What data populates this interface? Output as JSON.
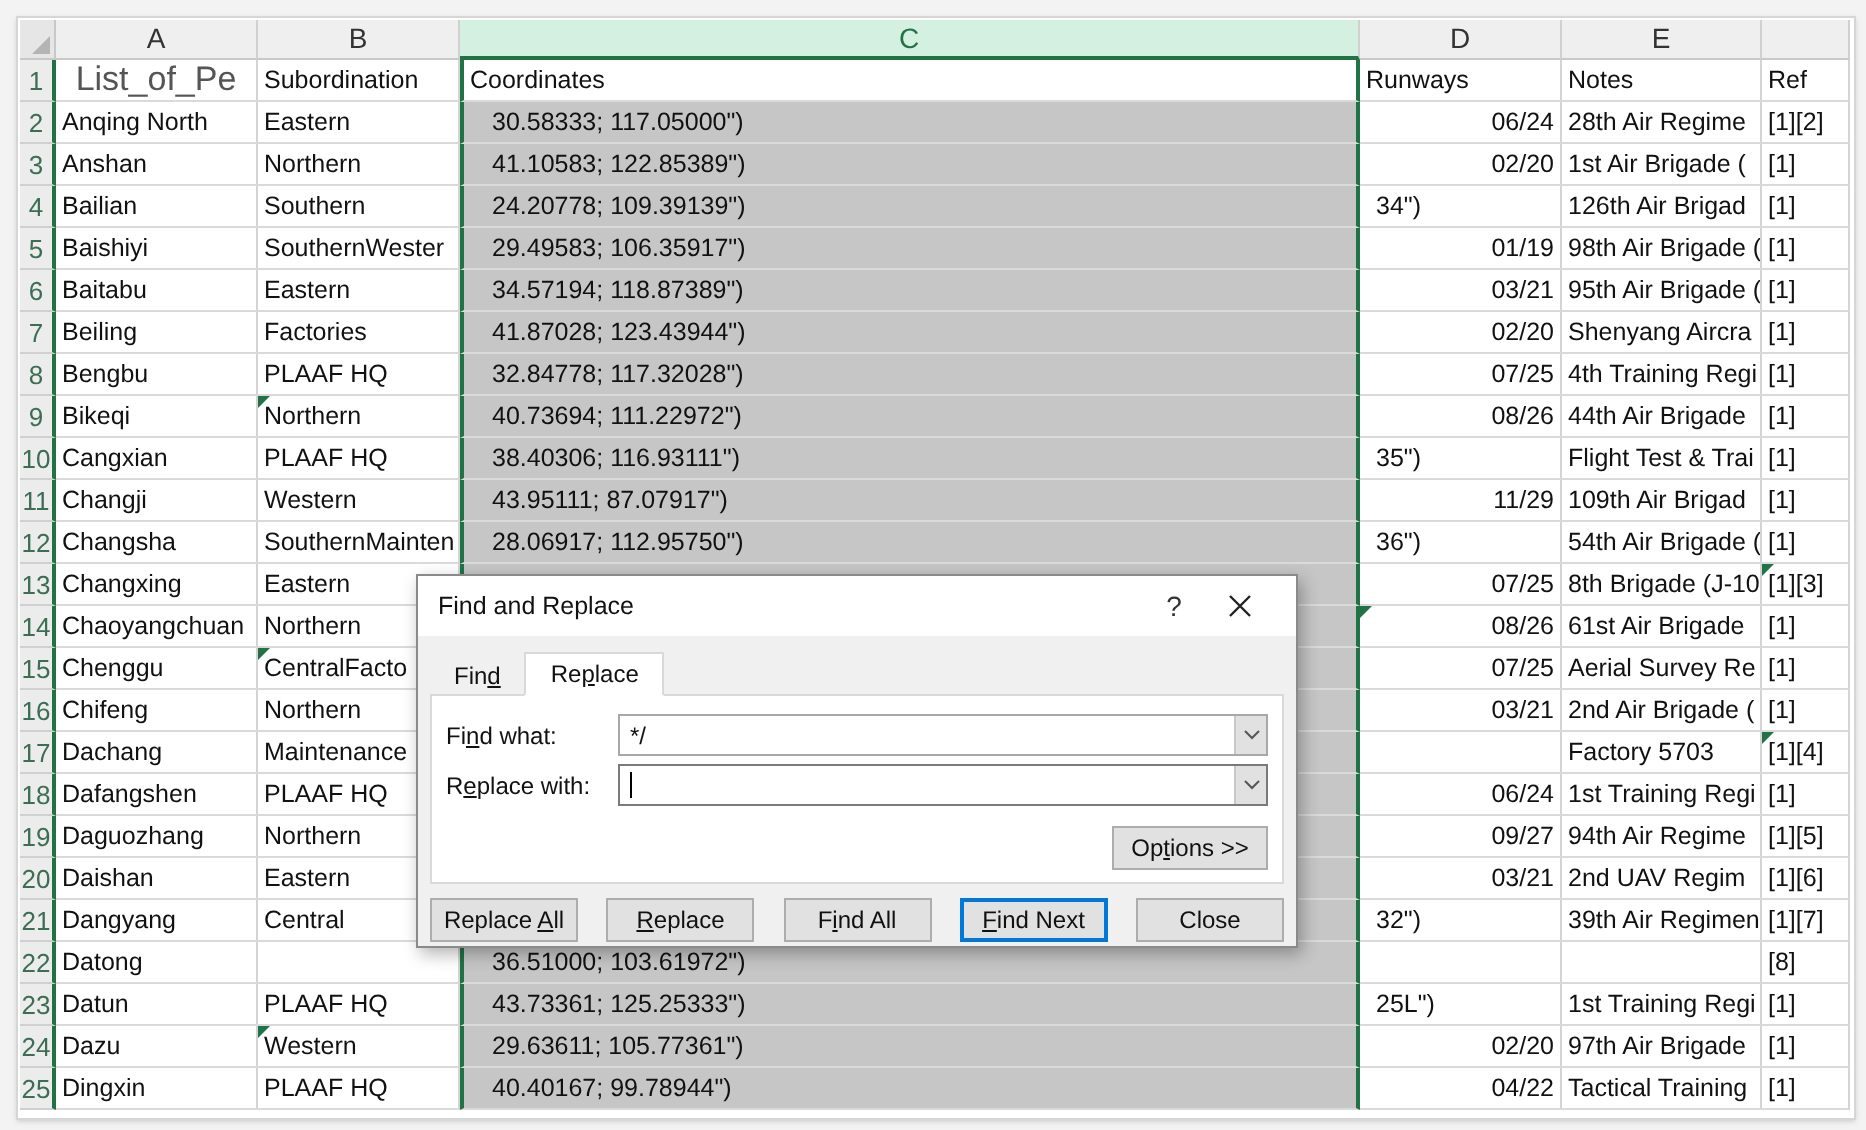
{
  "columns": [
    {
      "label": "A",
      "selected": false
    },
    {
      "label": "B",
      "selected": false
    },
    {
      "label": "C",
      "selected": true
    },
    {
      "label": "D",
      "selected": false
    },
    {
      "label": "E",
      "selected": false
    },
    {
      "selected": false
    }
  ],
  "header_row": {
    "number": "1",
    "cells": [
      "List_of_Pe",
      "Subordination",
      "Coordinates",
      "Runways",
      "Notes",
      "Ref"
    ]
  },
  "rows": [
    {
      "number": "2",
      "cells": [
        "Anqing North",
        "Eastern",
        "30.58333; 117.05000\")",
        {
          "text": "06/24",
          "kind": "date"
        },
        "28th Air Regime",
        "[1][2]"
      ],
      "marked": [
        false,
        false,
        false,
        false,
        false,
        false
      ]
    },
    {
      "number": "3",
      "cells": [
        "Anshan",
        "Northern",
        "41.10583; 122.85389\")",
        {
          "text": "02/20",
          "kind": "date"
        },
        "1st Air Brigade (",
        "[1]"
      ],
      "marked": [
        false,
        false,
        false,
        false,
        false,
        false
      ]
    },
    {
      "number": "4",
      "cells": [
        "Bailian",
        "Southern",
        "24.20778; 109.39139\")",
        {
          "text": "34\")",
          "kind": "overflow"
        },
        "126th Air Brigad",
        "[1]"
      ],
      "marked": [
        false,
        false,
        false,
        false,
        false,
        false
      ]
    },
    {
      "number": "5",
      "cells": [
        "Baishiyi",
        "SouthernWester",
        "29.49583; 106.35917\")",
        {
          "text": "01/19",
          "kind": "date"
        },
        "98th Air Brigade (",
        "[1]"
      ],
      "marked": [
        false,
        false,
        false,
        false,
        false,
        false
      ]
    },
    {
      "number": "6",
      "cells": [
        "Baitabu",
        "Eastern",
        "34.57194; 118.87389\")",
        {
          "text": "03/21",
          "kind": "date"
        },
        "95th Air Brigade (",
        "[1]"
      ],
      "marked": [
        false,
        false,
        false,
        false,
        false,
        false
      ]
    },
    {
      "number": "7",
      "cells": [
        "Beiling",
        "Factories",
        "41.87028; 123.43944\")",
        {
          "text": "02/20",
          "kind": "date"
        },
        "Shenyang Aircra",
        "[1]"
      ],
      "marked": [
        false,
        false,
        false,
        false,
        false,
        false
      ]
    },
    {
      "number": "8",
      "cells": [
        "Bengbu",
        "PLAAF HQ",
        "32.84778; 117.32028\")",
        {
          "text": "07/25",
          "kind": "date"
        },
        "4th Training Regi",
        "[1]"
      ],
      "marked": [
        false,
        false,
        false,
        false,
        false,
        false
      ]
    },
    {
      "number": "9",
      "cells": [
        "Bikeqi",
        "Northern",
        "40.73694; 111.22972\")",
        {
          "text": "08/26",
          "kind": "date"
        },
        "44th Air Brigade",
        "[1]"
      ],
      "marked": [
        false,
        true,
        false,
        false,
        false,
        false
      ]
    },
    {
      "number": "10",
      "cells": [
        "Cangxian",
        "PLAAF HQ",
        "38.40306; 116.93111\")",
        {
          "text": "35\")",
          "kind": "overflow"
        },
        "Flight Test & Trai",
        "[1]"
      ],
      "marked": [
        false,
        false,
        false,
        false,
        false,
        false
      ]
    },
    {
      "number": "11",
      "cells": [
        "Changji",
        "Western",
        "43.95111; 87.07917\")",
        {
          "text": "11/29",
          "kind": "date"
        },
        "109th Air Brigad",
        "[1]"
      ],
      "marked": [
        false,
        false,
        false,
        false,
        false,
        false
      ]
    },
    {
      "number": "12",
      "cells": [
        "Changsha",
        "SouthernMainten",
        "28.06917; 112.95750\")",
        {
          "text": "36\")",
          "kind": "overflow"
        },
        "54th Air Brigade (",
        "[1]"
      ],
      "marked": [
        false,
        false,
        false,
        false,
        false,
        false
      ]
    },
    {
      "number": "13",
      "cells": [
        "Changxing",
        "Eastern",
        null,
        {
          "text": "07/25",
          "kind": "date"
        },
        "8th Brigade (J-10",
        "[1][3]"
      ],
      "marked": [
        false,
        false,
        false,
        false,
        false,
        true
      ]
    },
    {
      "number": "14",
      "cells": [
        "Chaoyangchuan",
        "Northern",
        null,
        {
          "text": "08/26",
          "kind": "date"
        },
        "61st Air Brigade",
        "[1]"
      ],
      "marked": [
        false,
        false,
        false,
        true,
        false,
        false
      ]
    },
    {
      "number": "15",
      "cells": [
        "Chenggu",
        "CentralFacto",
        null,
        {
          "text": "07/25",
          "kind": "date"
        },
        "Aerial Survey Re",
        "[1]"
      ],
      "marked": [
        false,
        true,
        false,
        false,
        false,
        false
      ]
    },
    {
      "number": "16",
      "cells": [
        "Chifeng",
        "Northern",
        null,
        {
          "text": "03/21",
          "kind": "date"
        },
        "2nd Air Brigade (",
        "[1]"
      ],
      "marked": [
        false,
        false,
        false,
        false,
        false,
        false
      ]
    },
    {
      "number": "17",
      "cells": [
        "Dachang",
        "Maintenance",
        null,
        null,
        "Factory 5703",
        "[1][4]"
      ],
      "marked": [
        false,
        false,
        false,
        false,
        false,
        true
      ]
    },
    {
      "number": "18",
      "cells": [
        "Dafangshen",
        "PLAAF HQ",
        null,
        {
          "text": "06/24",
          "kind": "date"
        },
        "1st Training Regi",
        "[1]"
      ],
      "marked": [
        false,
        false,
        false,
        false,
        false,
        false
      ]
    },
    {
      "number": "19",
      "cells": [
        "Daguozhang",
        "Northern",
        null,
        {
          "text": "09/27",
          "kind": "date"
        },
        "94th Air Regime",
        "[1][5]"
      ],
      "marked": [
        false,
        false,
        false,
        false,
        false,
        false
      ]
    },
    {
      "number": "20",
      "cells": [
        "Daishan",
        "Eastern",
        null,
        {
          "text": "03/21",
          "kind": "date"
        },
        "2nd UAV Regim",
        "[1][6]"
      ],
      "marked": [
        false,
        false,
        false,
        false,
        false,
        false
      ]
    },
    {
      "number": "21",
      "cells": [
        "Dangyang",
        "Central",
        null,
        {
          "text": "32\")",
          "kind": "overflow"
        },
        "39th Air Regimen",
        "[1][7]"
      ],
      "marked": [
        false,
        false,
        false,
        false,
        false,
        false
      ]
    },
    {
      "number": "22",
      "cells": [
        "Datong",
        null,
        "36.51000; 103.61972\")",
        null,
        null,
        "[8]"
      ],
      "marked": [
        false,
        false,
        false,
        false,
        false,
        false
      ]
    },
    {
      "number": "23",
      "cells": [
        "Datun",
        "PLAAF HQ",
        "43.73361; 125.25333\")",
        {
          "text": "25L\")",
          "kind": "overflow"
        },
        "1st Training Regi",
        "[1]"
      ],
      "marked": [
        false,
        false,
        false,
        false,
        false,
        false
      ]
    },
    {
      "number": "24",
      "cells": [
        "Dazu",
        "Western",
        "29.63611; 105.77361\")",
        {
          "text": "02/20",
          "kind": "date"
        },
        "97th Air Brigade",
        "[1]"
      ],
      "marked": [
        false,
        true,
        false,
        false,
        false,
        false
      ]
    },
    {
      "number": "25",
      "cells": [
        "Dingxin",
        "PLAAF HQ",
        "40.40167; 99.78944\")",
        {
          "text": "04/22",
          "kind": "date"
        },
        "Tactical Training",
        "[1]"
      ],
      "marked": [
        false,
        false,
        false,
        false,
        false,
        false
      ]
    }
  ],
  "dialog": {
    "title": "Find and Replace",
    "help": "?",
    "tabs": [
      {
        "label": {
          "pre": "Fin",
          "key": "d"
        },
        "selected": false
      },
      {
        "label": {
          "pre": "Re",
          "key": "p",
          "post": "lace"
        },
        "selected": true
      }
    ],
    "fields": [
      {
        "label": {
          "pre": "Fi",
          "key": "n",
          "post": "d what:"
        },
        "value": "*/",
        "focused": false
      },
      {
        "label": {
          "pre": "R",
          "key": "e",
          "post": "place with:"
        },
        "focused": true
      }
    ],
    "options_button": {
      "pre": "Op",
      "key": "t",
      "post": "ions >>"
    },
    "buttons": [
      {
        "label": {
          "pre": "Replace ",
          "key": "A",
          "post": "ll"
        },
        "default": false
      },
      {
        "label": {
          "key": "R",
          "post": "eplace"
        },
        "default": false
      },
      {
        "label": {
          "pre": "F",
          "key": "i",
          "post": "nd All"
        },
        "default": false
      },
      {
        "label": {
          "key": "F",
          "post": "ind Next"
        },
        "default": true
      },
      {
        "label": {
          "pre": "Close"
        },
        "default": false
      }
    ]
  }
}
